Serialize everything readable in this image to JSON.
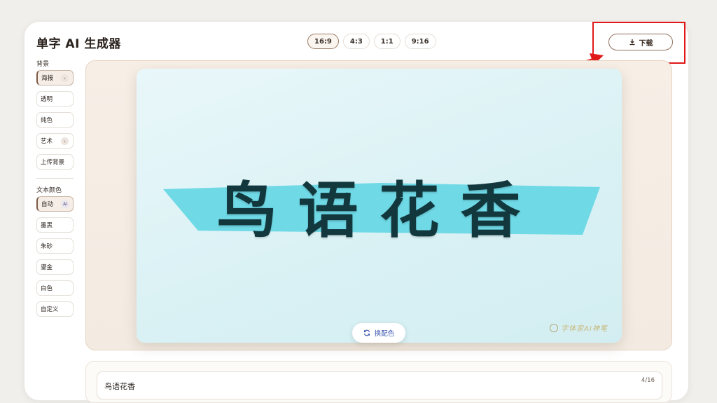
{
  "app": {
    "title": "单字 AI 生成器"
  },
  "ratios": [
    "16:9",
    "4:3",
    "1:1",
    "9:16"
  ],
  "active_ratio": "16:9",
  "download_label": "下载",
  "background": {
    "label": "背景",
    "options": [
      "海报",
      "透明",
      "纯色",
      "艺术",
      "上传背景"
    ],
    "active": "海报"
  },
  "text_color": {
    "label": "文本颜色",
    "options": [
      "自动",
      "墨黑",
      "朱砂",
      "鎏金",
      "白色",
      "自定义"
    ],
    "active": "自动",
    "ai_badge": "AI"
  },
  "poster": {
    "text": "鸟语花香",
    "watermark": "字体家AI神笔",
    "text_color": "#12383e",
    "band_color": "#6fd9e6",
    "bg_color": "#dff3f6"
  },
  "swap_label": "换配色",
  "input": {
    "value": "鸟语花香",
    "counter": "4/16"
  },
  "colors": {
    "accent": "#8f6f5c",
    "annotation": "#e01818"
  }
}
